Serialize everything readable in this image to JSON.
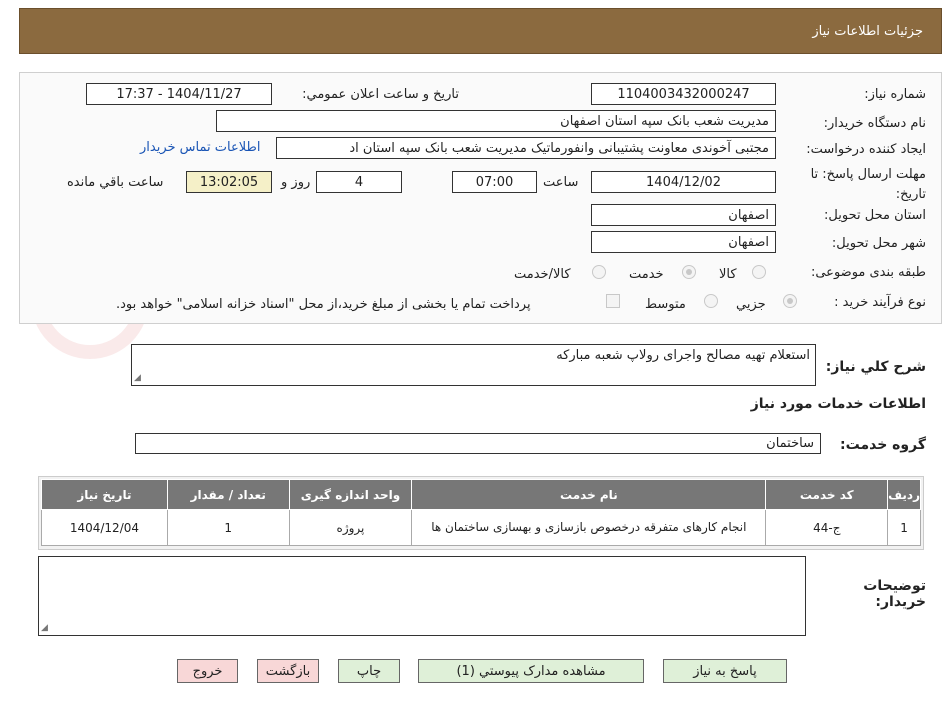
{
  "header": {
    "title": "جزئیات اطلاعات نیاز"
  },
  "form": {
    "need_number": {
      "label": "شماره نیاز:",
      "value": "1104003432000247"
    },
    "announce_datetime": {
      "label": "تاریخ و ساعت اعلان عمومي:",
      "value": "1404/11/27 - 17:37"
    },
    "buyer_org": {
      "label": "نام دستگاه خریدار:",
      "value": "مدیریت شعب بانک سپه استان اصفهان"
    },
    "requester": {
      "label": "ایجاد کننده درخواست:",
      "value": "مجتبی آخوندی معاونت پشتیبانی وانفورماتیک مدیریت شعب بانک سپه استان اد"
    },
    "buyer_contact_link": "اطلاعات تماس خریدار",
    "deadline": {
      "label": "مهلت ارسال پاسخ: تا تاریخ:",
      "date": "1404/12/02",
      "time_label": "ساعت",
      "time": "07:00",
      "days": "4",
      "days_label": "روز و",
      "remaining": "13:02:05",
      "remaining_label": "ساعت باقي مانده"
    },
    "delivery_province": {
      "label": "استان محل تحویل:",
      "value": "اصفهان"
    },
    "delivery_city": {
      "label": "شهر محل تحویل:",
      "value": "اصفهان"
    },
    "category": {
      "label": "طبقه بندی موضوعی:",
      "options": [
        "کالا",
        "خدمت",
        "کالا/خدمت"
      ],
      "selected": "خدمت"
    },
    "purchase_type": {
      "label": "نوع فرآیند خرید :",
      "options": [
        "جزيي",
        "متوسط"
      ],
      "selected": "جزيي",
      "note": "پرداخت تمام یا بخشی از مبلغ خرید،از محل \"اسناد خزانه اسلامی\" خواهد بود."
    }
  },
  "summary": {
    "label": "شرح کلي نیاز:",
    "value": "استعلام تهیه مصالح واجرای رولاپ شعبه مبارکه"
  },
  "services": {
    "section_title": "اطلاعات خدمات مورد نیاز",
    "group_label": "گروه خدمت:",
    "group_value": "ساختمان",
    "columns": [
      "ردیف",
      "کد خدمت",
      "نام خدمت",
      "واحد اندازه گیری",
      "تعداد / مقدار",
      "تاریخ نیاز"
    ],
    "rows": [
      [
        "1",
        "ج-44",
        "انجام کارهای متفرقه درخصوص بازسازی و بهسازی ساختمان ها",
        "پروژه",
        "1",
        "1404/12/04"
      ]
    ]
  },
  "buyer_notes": {
    "label_line1": "توضیحات",
    "label_line2": "خریدار:",
    "value": ""
  },
  "buttons": {
    "reply": "پاسخ به نیاز",
    "attachments": "مشاهده مدارک پیوستي (1)",
    "print": "چاپ",
    "back": "بازگشت",
    "exit": "خروج"
  },
  "colors": {
    "header_bg": "#8b6a3f",
    "button_green": "#dff0d8",
    "button_pink": "#f8d7d7",
    "table_header": "#777777"
  }
}
